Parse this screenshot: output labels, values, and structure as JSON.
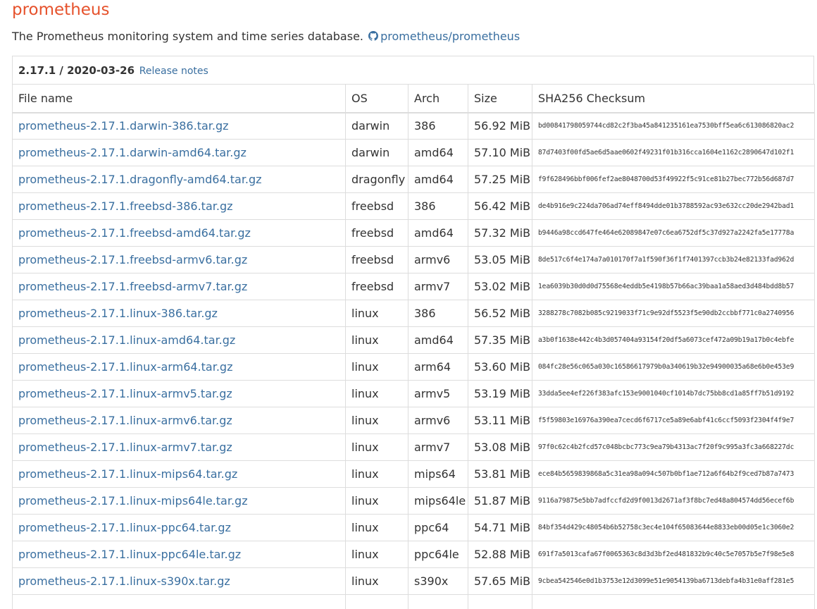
{
  "header": {
    "title": "prometheus",
    "description": "The Prometheus monitoring system and time series database.",
    "repo_link": "prometheus/prometheus",
    "repo_icon": "github-icon"
  },
  "release": {
    "version_date": "2.17.1 / 2020-03-26",
    "notes_link": "Release notes"
  },
  "table": {
    "columns": [
      "File name",
      "OS",
      "Arch",
      "Size",
      "SHA256 Checksum"
    ],
    "rows": [
      {
        "file": "prometheus-2.17.1.darwin-386.tar.gz",
        "os": "darwin",
        "arch": "386",
        "size": "56.92 MiB",
        "sha": "bd00841798059744cd82c2f3ba45a841235161ea7530bff5ea6c613086820ac2"
      },
      {
        "file": "prometheus-2.17.1.darwin-amd64.tar.gz",
        "os": "darwin",
        "arch": "amd64",
        "size": "57.10 MiB",
        "sha": "87d7403f00fd5ae6d5aae0602f49231f01b316cca1604e1162c2890647d102f1"
      },
      {
        "file": "prometheus-2.17.1.dragonfly-amd64.tar.gz",
        "os": "dragonfly",
        "arch": "amd64",
        "size": "57.25 MiB",
        "sha": "f9f628496bbf006fef2ae8048700d53f49922f5c91ce81b27bec772b56d687d7"
      },
      {
        "file": "prometheus-2.17.1.freebsd-386.tar.gz",
        "os": "freebsd",
        "arch": "386",
        "size": "56.42 MiB",
        "sha": "de4b916e9c224da706ad74eff8494dde01b3788592ac93e632cc20de2942bad1"
      },
      {
        "file": "prometheus-2.17.1.freebsd-amd64.tar.gz",
        "os": "freebsd",
        "arch": "amd64",
        "size": "57.32 MiB",
        "sha": "b9446a98ccd647fe464e62089847e07c6ea6752df5c37d927a2242fa5e17778a"
      },
      {
        "file": "prometheus-2.17.1.freebsd-armv6.tar.gz",
        "os": "freebsd",
        "arch": "armv6",
        "size": "53.05 MiB",
        "sha": "8de517c6f4e174a7a010170f7a1f590f36f1f7401397ccb3b24e82133fad962d"
      },
      {
        "file": "prometheus-2.17.1.freebsd-armv7.tar.gz",
        "os": "freebsd",
        "arch": "armv7",
        "size": "53.02 MiB",
        "sha": "1ea6039b30d0d0d75568e4eddb5e4198b57b66ac39baa1a58aed3d484bdd8b57"
      },
      {
        "file": "prometheus-2.17.1.linux-386.tar.gz",
        "os": "linux",
        "arch": "386",
        "size": "56.52 MiB",
        "sha": "3288278c7082b085c9219033f71c9e92df5523f5e90db2ccbbf771c0a2740956"
      },
      {
        "file": "prometheus-2.17.1.linux-amd64.tar.gz",
        "os": "linux",
        "arch": "amd64",
        "size": "57.35 MiB",
        "sha": "a3b0f1638e442c4b3d057404a93154f20df5a6073cef472a09b19a17b0c4ebfe"
      },
      {
        "file": "prometheus-2.17.1.linux-arm64.tar.gz",
        "os": "linux",
        "arch": "arm64",
        "size": "53.60 MiB",
        "sha": "084fc28e56c065a030c16586617979b0a340619b32e94900035a68e6b0e453e9"
      },
      {
        "file": "prometheus-2.17.1.linux-armv5.tar.gz",
        "os": "linux",
        "arch": "armv5",
        "size": "53.19 MiB",
        "sha": "33dda5ee4ef226f383afc153e9001040cf1014b7dc75bb8cd1a85ff7b51d9192"
      },
      {
        "file": "prometheus-2.17.1.linux-armv6.tar.gz",
        "os": "linux",
        "arch": "armv6",
        "size": "53.11 MiB",
        "sha": "f5f59803e16976a390ea7cecd6f6717ce5a89e6abf41c6ccf5093f2304f4f9e7"
      },
      {
        "file": "prometheus-2.17.1.linux-armv7.tar.gz",
        "os": "linux",
        "arch": "armv7",
        "size": "53.08 MiB",
        "sha": "97f0c62c4b2fcd57c048bcbc773c9ea79b4313ac7f20f9c995a3fc3a668227dc"
      },
      {
        "file": "prometheus-2.17.1.linux-mips64.tar.gz",
        "os": "linux",
        "arch": "mips64",
        "size": "53.81 MiB",
        "sha": "ece84b5659839868a5c31ea98a094c507b0bf1ae712a6f64b2f9ced7b87a7473"
      },
      {
        "file": "prometheus-2.17.1.linux-mips64le.tar.gz",
        "os": "linux",
        "arch": "mips64le",
        "size": "51.87 MiB",
        "sha": "9116a79875e5bb7adfccfd2d9f0013d2671af3f8bc7ed48a804574dd56ecef6b"
      },
      {
        "file": "prometheus-2.17.1.linux-ppc64.tar.gz",
        "os": "linux",
        "arch": "ppc64",
        "size": "54.71 MiB",
        "sha": "84bf354d429c48054b6b52758c3ec4e104f65083644e8833eb00d05e1c3060e2"
      },
      {
        "file": "prometheus-2.17.1.linux-ppc64le.tar.gz",
        "os": "linux",
        "arch": "ppc64le",
        "size": "52.88 MiB",
        "sha": "691f7a5013cafa67f0065363c8d3d3bf2ed481832b9c40c5e7057b5e7f98e5e8"
      },
      {
        "file": "prometheus-2.17.1.linux-s390x.tar.gz",
        "os": "linux",
        "arch": "s390x",
        "size": "57.65 MiB",
        "sha": "9cbea542546e0d1b3753e12d3099e51e9054139ba6713debfa4b31e0aff281e5"
      },
      {
        "file": "",
        "os": "",
        "arch": "",
        "size": "",
        "sha": ""
      }
    ]
  },
  "colors": {
    "title": "#e6522c",
    "link": "#3a6fa0",
    "text": "#333333",
    "border": "#dddddd"
  }
}
